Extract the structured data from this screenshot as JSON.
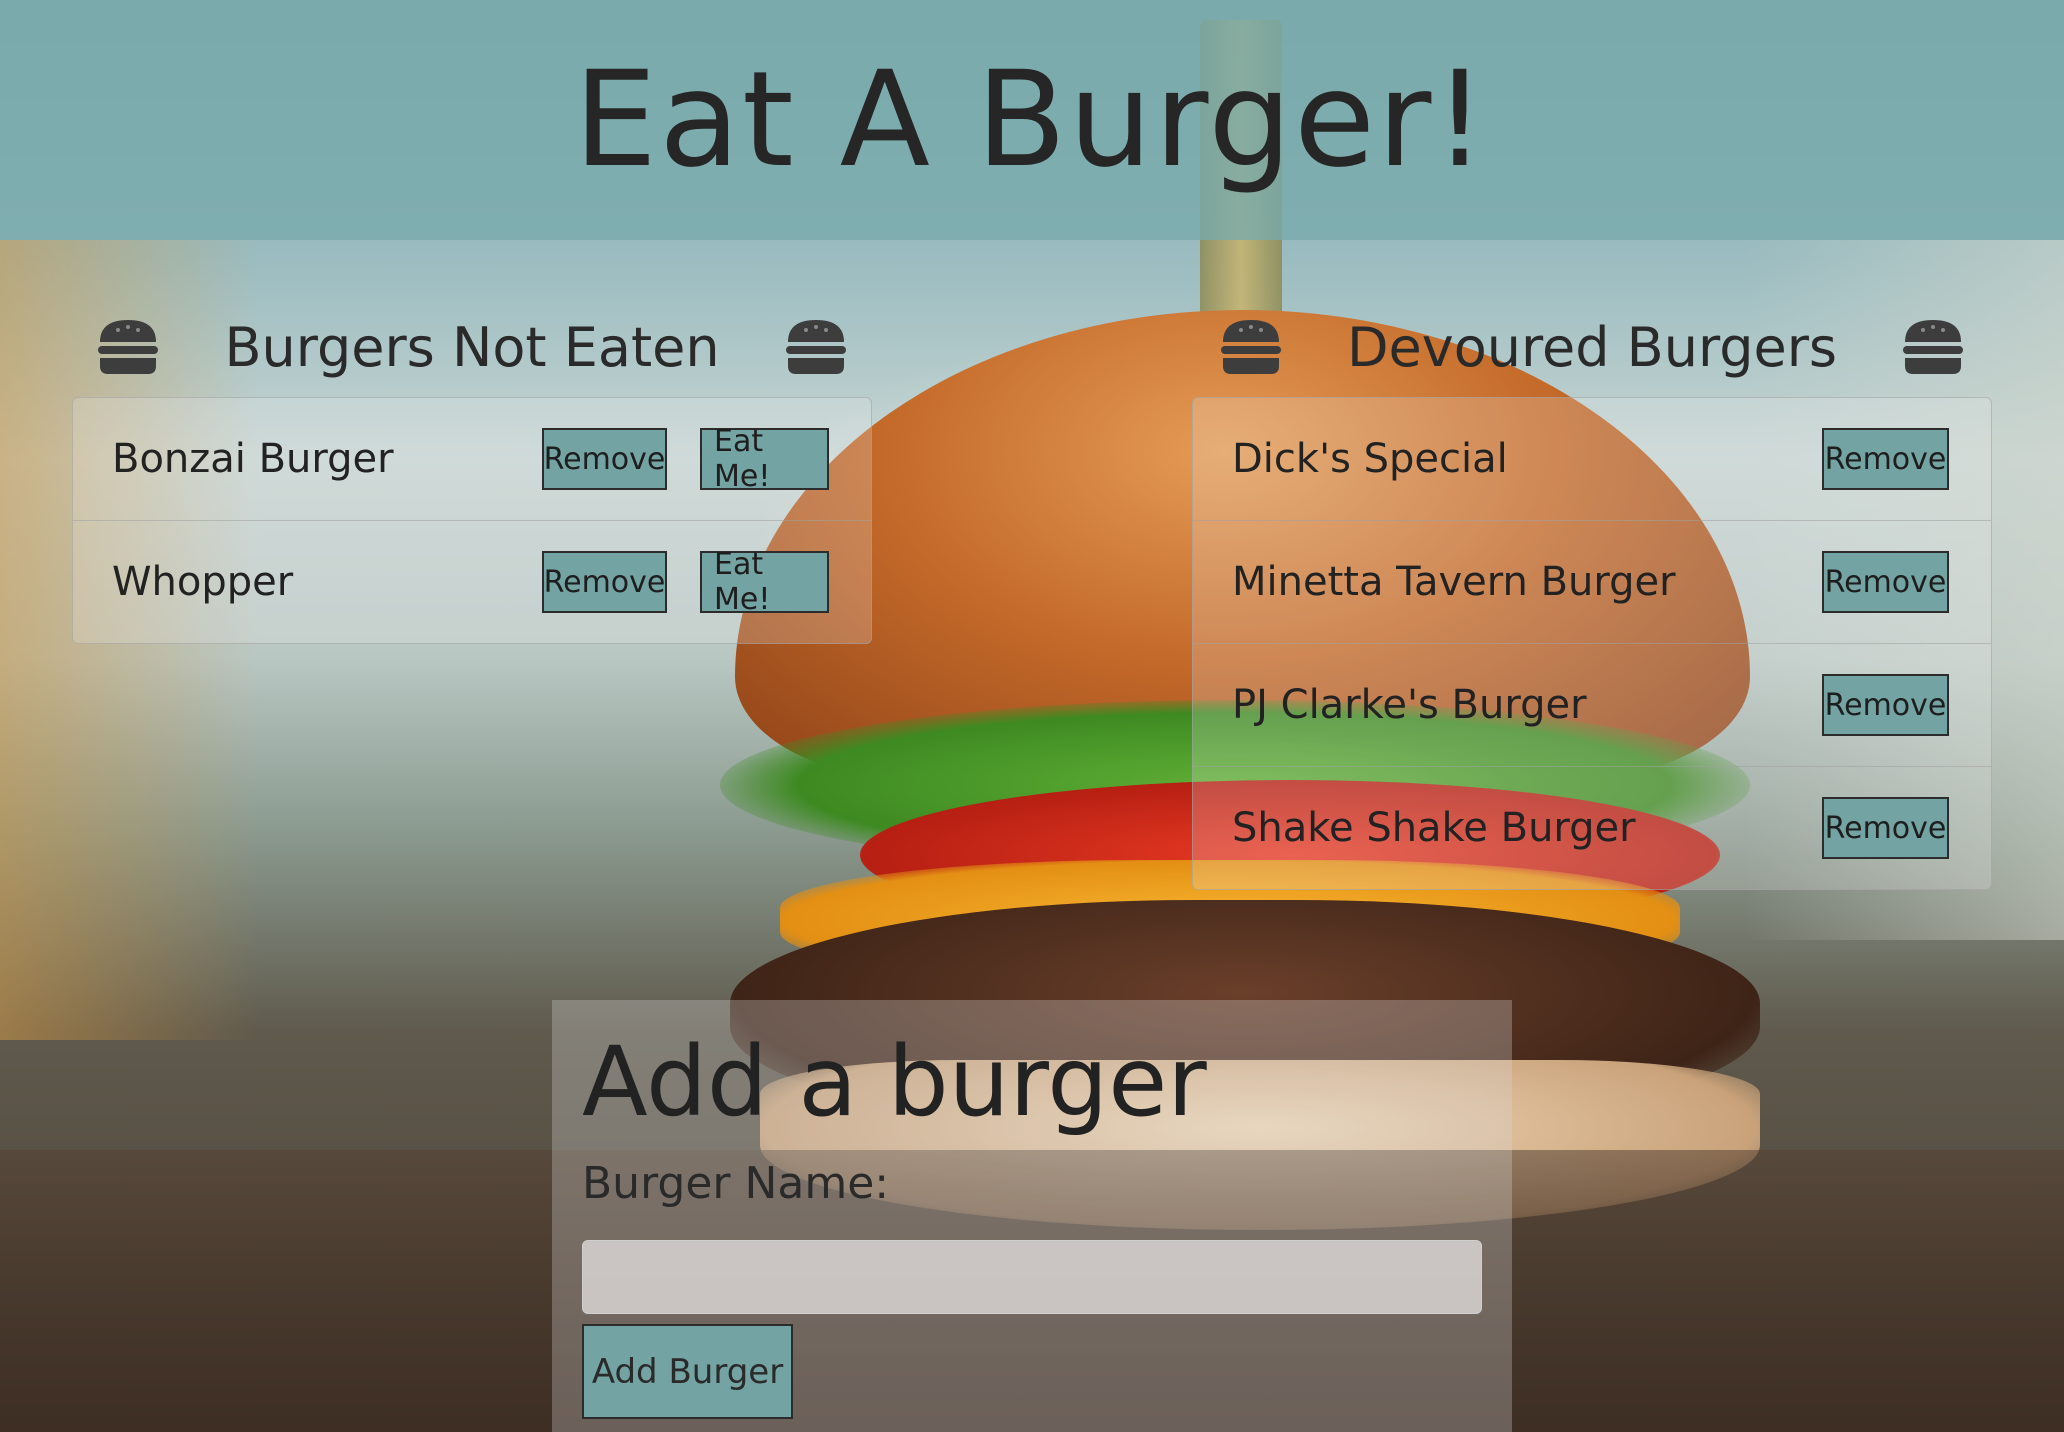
{
  "header": {
    "title": "Eat A Burger!"
  },
  "not_eaten": {
    "heading": "Burgers Not Eaten",
    "items": [
      {
        "name": "Bonzai Burger",
        "remove_label": "Remove",
        "eat_label": "Eat Me!"
      },
      {
        "name": "Whopper",
        "remove_label": "Remove",
        "eat_label": "Eat Me!"
      }
    ]
  },
  "devoured": {
    "heading": "Devoured Burgers",
    "items": [
      {
        "name": "Dick's Special",
        "remove_label": "Remove"
      },
      {
        "name": "Minetta Tavern Burger",
        "remove_label": "Remove"
      },
      {
        "name": "PJ Clarke's Burger",
        "remove_label": "Remove"
      },
      {
        "name": "Shake Shake Burger",
        "remove_label": "Remove"
      }
    ]
  },
  "add_form": {
    "heading": "Add a burger",
    "name_label": "Burger Name:",
    "name_value": "",
    "submit_label": "Add Burger"
  },
  "icons": {
    "heading_icon": "hamburger-icon"
  },
  "colors": {
    "button_bg": "#73a3a3",
    "header_bg": "#79aaac",
    "text": "#222222"
  }
}
